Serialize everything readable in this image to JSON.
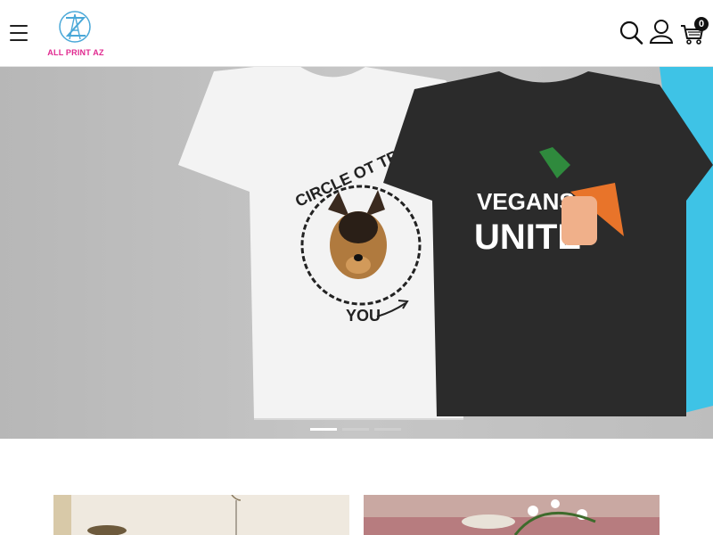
{
  "header": {
    "menu_icon": "hamburger-menu-icon",
    "logo_text": "ALL PRINT AZ",
    "icons": [
      "search-icon",
      "user-icon",
      "cart-icon"
    ],
    "cart_count": "0",
    "brand_colors": {
      "logo_blue": "#4aa8d8",
      "logo_pink": "#e0288f"
    }
  },
  "hero": {
    "slides_count": 3,
    "active_slide": 1,
    "shirt_1_text_top": "CIRCLE OT TRU",
    "shirt_1_text_bottom": "YOU",
    "shirt_2_text_line1": "VEGANS",
    "shirt_2_text_line2": "UNITE"
  }
}
